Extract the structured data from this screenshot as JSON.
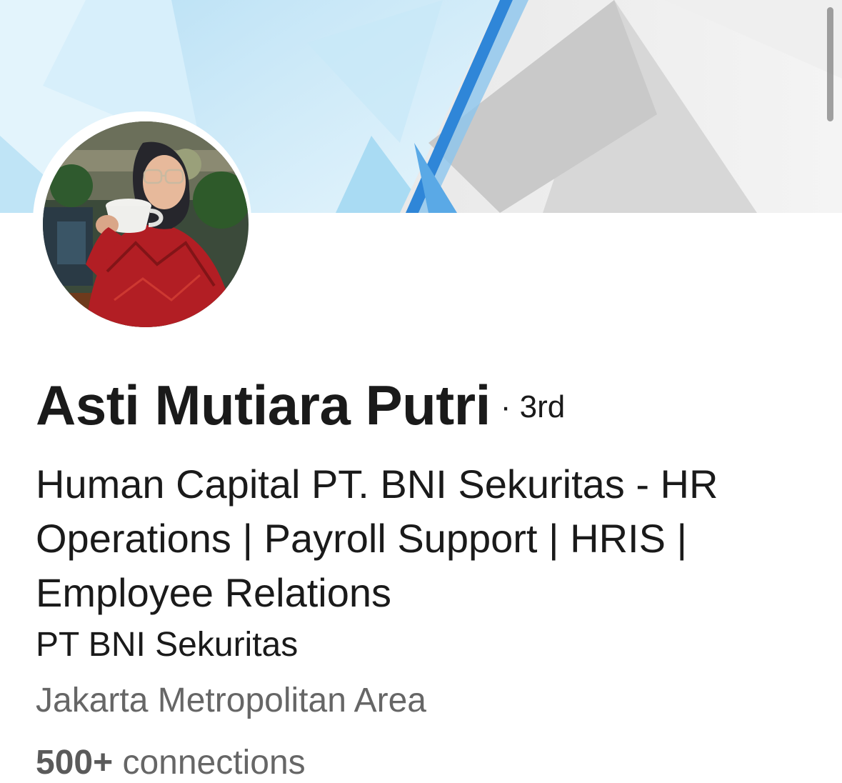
{
  "profile": {
    "name": "Asti Mutiara Putri",
    "degree": "· 3rd",
    "headline": "Human Capital PT. BNI Sekuritas - HR Operations | Payroll Support | HRIS | Employee Relations",
    "company": "PT BNI Sekuritas",
    "location": "Jakarta Metropolitan Area",
    "connections_count": "500+",
    "connections_label": "connections"
  },
  "colors": {
    "text_primary": "#1a1a1a",
    "text_secondary": "#666666",
    "banner_blue": "#2f86d8",
    "banner_light": "#dff1fb",
    "banner_gray": "#d9d9d9"
  },
  "icons": {
    "avatar": "profile-photo"
  }
}
